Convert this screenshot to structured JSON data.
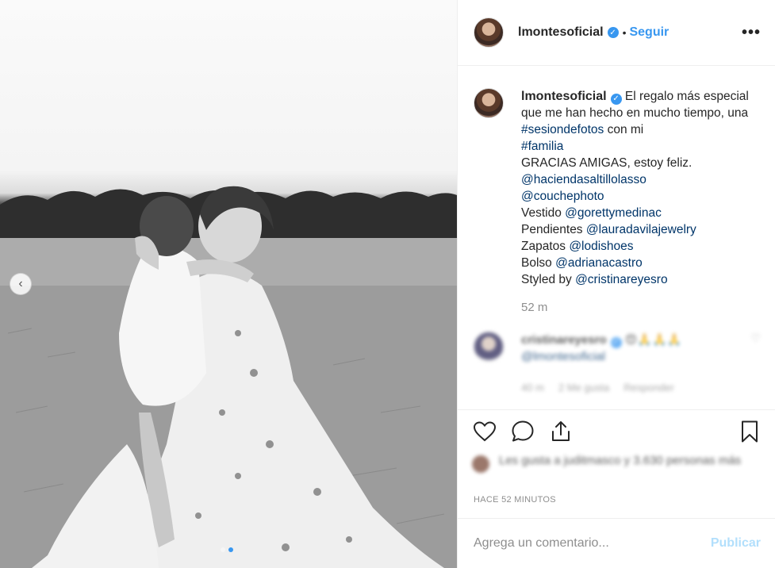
{
  "post": {
    "username": "lmontesoficial",
    "follow_label": "Seguir",
    "bullet": "•",
    "more_label": "•••",
    "caption": {
      "text_1": "El regalo más especial que me han hecho en mucho tiempo, una ",
      "hashtag_1": "#sesiondefotos",
      "text_2": " con mi ",
      "hashtag_2": "#familia",
      "line_thanks": "GRACIAS AMIGAS, estoy feliz.",
      "mention_1": "@haciendasaltillolasso",
      "mention_2": "@couchephoto",
      "vestido_label": "Vestido ",
      "vestido_tag": "@gorettymedinac",
      "pendientes_label": "Pendientes ",
      "pendientes_tag": "@lauradavilajewelry",
      "zapatos_label": "Zapatos ",
      "zapatos_tag": "@lodishoes",
      "bolso_label": "Bolso ",
      "bolso_tag": "@adrianacastro",
      "styled_label": "Styled by ",
      "styled_tag": "@cristinareyesro",
      "timestamp": "52 m"
    },
    "comment": {
      "username": "cristinareyesro",
      "mention": "@lmontesoficial",
      "emojis": "😍🙏🙏🙏",
      "time": "40 m",
      "likes": "2 Me gusta",
      "reply": "Responder"
    },
    "likes_text": "Les gusta a juditmasco y 3.630 personas más",
    "ago": "HACE 52 MINUTOS",
    "add_comment_placeholder": "Agrega un comentario...",
    "publish_label": "Publicar"
  },
  "icons": {
    "carousel_prev": "chevron-left-icon",
    "verified": "verified-badge-icon",
    "like": "heart-icon",
    "comment": "comment-bubble-icon",
    "share": "share-icon",
    "save": "bookmark-icon"
  },
  "colors": {
    "link": "#3897f0",
    "tag": "#003569",
    "muted": "#8e8e8e",
    "publish_disabled": "#b2dffc"
  }
}
